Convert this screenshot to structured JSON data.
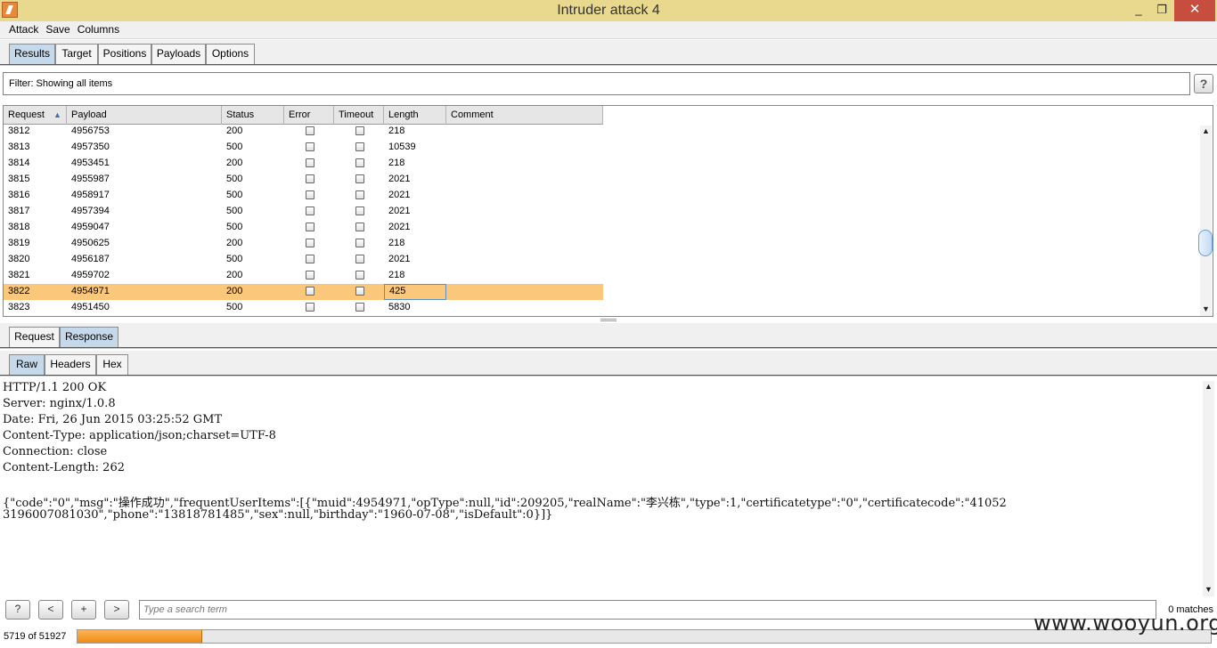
{
  "window": {
    "title": "Intruder attack 4",
    "minimize": "_",
    "maximize": "❐",
    "close": "✕"
  },
  "menu": [
    "Attack",
    "Save",
    "Columns"
  ],
  "main_tabs": [
    "Results",
    "Target",
    "Positions",
    "Payloads",
    "Options"
  ],
  "filter": {
    "text": "Filter: Showing all items",
    "help": "?"
  },
  "table": {
    "columns": [
      "Request",
      "Payload",
      "Status",
      "Error",
      "Timeout",
      "Length",
      "Comment"
    ],
    "sort_indicator": "▲",
    "rows": [
      {
        "request": "3812",
        "payload": "4956753",
        "status": "200",
        "length": "218"
      },
      {
        "request": "3813",
        "payload": "4957350",
        "status": "500",
        "length": "10539"
      },
      {
        "request": "3814",
        "payload": "4953451",
        "status": "200",
        "length": "218"
      },
      {
        "request": "3815",
        "payload": "4955987",
        "status": "500",
        "length": "2021"
      },
      {
        "request": "3816",
        "payload": "4958917",
        "status": "500",
        "length": "2021"
      },
      {
        "request": "3817",
        "payload": "4957394",
        "status": "500",
        "length": "2021"
      },
      {
        "request": "3818",
        "payload": "4959047",
        "status": "500",
        "length": "2021"
      },
      {
        "request": "3819",
        "payload": "4950625",
        "status": "200",
        "length": "218"
      },
      {
        "request": "3820",
        "payload": "4956187",
        "status": "500",
        "length": "2021"
      },
      {
        "request": "3821",
        "payload": "4959702",
        "status": "200",
        "length": "218"
      },
      {
        "request": "3822",
        "payload": "4954971",
        "status": "200",
        "length": "425"
      },
      {
        "request": "3823",
        "payload": "4951450",
        "status": "500",
        "length": "5830"
      }
    ],
    "selected_color": "#fbc77b"
  },
  "detail_tabs": [
    "Request",
    "Response"
  ],
  "view_tabs": [
    "Raw",
    "Headers",
    "Hex"
  ],
  "response_lines": [
    "HTTP/1.1 200 OK",
    "Server: nginx/1.0.8",
    "Date: Fri, 26 Jun 2015 03:25:52 GMT",
    "Content-Type: application/json;charset=UTF-8",
    "Connection: close",
    "Content-Length: 262",
    "",
    "{\"code\":\"0\",\"msg\":\"操作成功\",\"frequentUserItems\":[{\"muid\":4954971,\"opType\":null,\"id\":209205,\"realName\":\"李兴栋\",\"type\":1,\"certificatetype\":\"0\",\"certificatecode\":\"41052",
    "3196007081030\",\"phone\":\"13818781485\",\"sex\":null,\"birthday\":\"1960-07-08\",\"isDefault\":0}]}"
  ],
  "search": {
    "help": "?",
    "prev": "<",
    "add": "+",
    "next": ">",
    "placeholder": "Type a search term",
    "matches": "0 matches"
  },
  "status": {
    "progress_text": "5719 of 51927",
    "progress_fraction": 0.1101
  },
  "watermark": "www.wooyun.org",
  "colors": {
    "titlebar": "#e8d98e",
    "active_tab": "#c5d9ea",
    "progress": "#f08a12"
  }
}
